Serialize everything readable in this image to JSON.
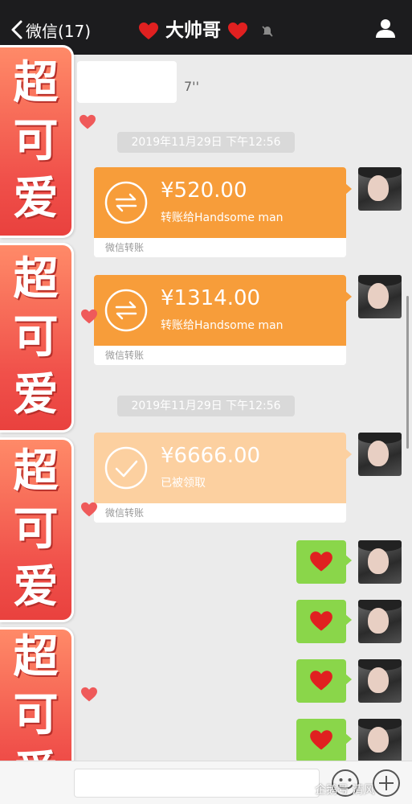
{
  "header": {
    "back_label": "微信(17)",
    "title": "大帅哥",
    "muted": true
  },
  "chat": {
    "voice_message": {
      "duration": "7''"
    },
    "timestamps": [
      "2019年11月29日 下午12:56",
      "2019年11月29日 下午12:56"
    ],
    "transfers": [
      {
        "amount": "¥520.00",
        "note": "转账给Handsome man",
        "footer": "微信转账",
        "status": "sent"
      },
      {
        "amount": "¥1314.00",
        "note": "转账给Handsome man",
        "footer": "微信转账",
        "status": "sent"
      },
      {
        "amount": "¥6666.00",
        "note": "已被领取",
        "footer": "微信转账",
        "status": "received"
      }
    ],
    "heart_messages": 4
  },
  "stickers": [
    {
      "chars": [
        "超",
        "可",
        "爱"
      ]
    },
    {
      "chars": [
        "超",
        "可",
        "爱"
      ]
    },
    {
      "chars": [
        "超",
        "可",
        "爱"
      ]
    },
    {
      "chars": [
        "超",
        "可",
        "爱"
      ]
    }
  ],
  "watermark": "企鹅号 清风",
  "colors": {
    "header_bg": "#1c1c1e",
    "transfer_orange": "#f79d3a",
    "transfer_received": "#fcd0a0",
    "bubble_green": "#8ad64a",
    "heart_red": "#e02020",
    "sticker_red": "#f0504a"
  }
}
